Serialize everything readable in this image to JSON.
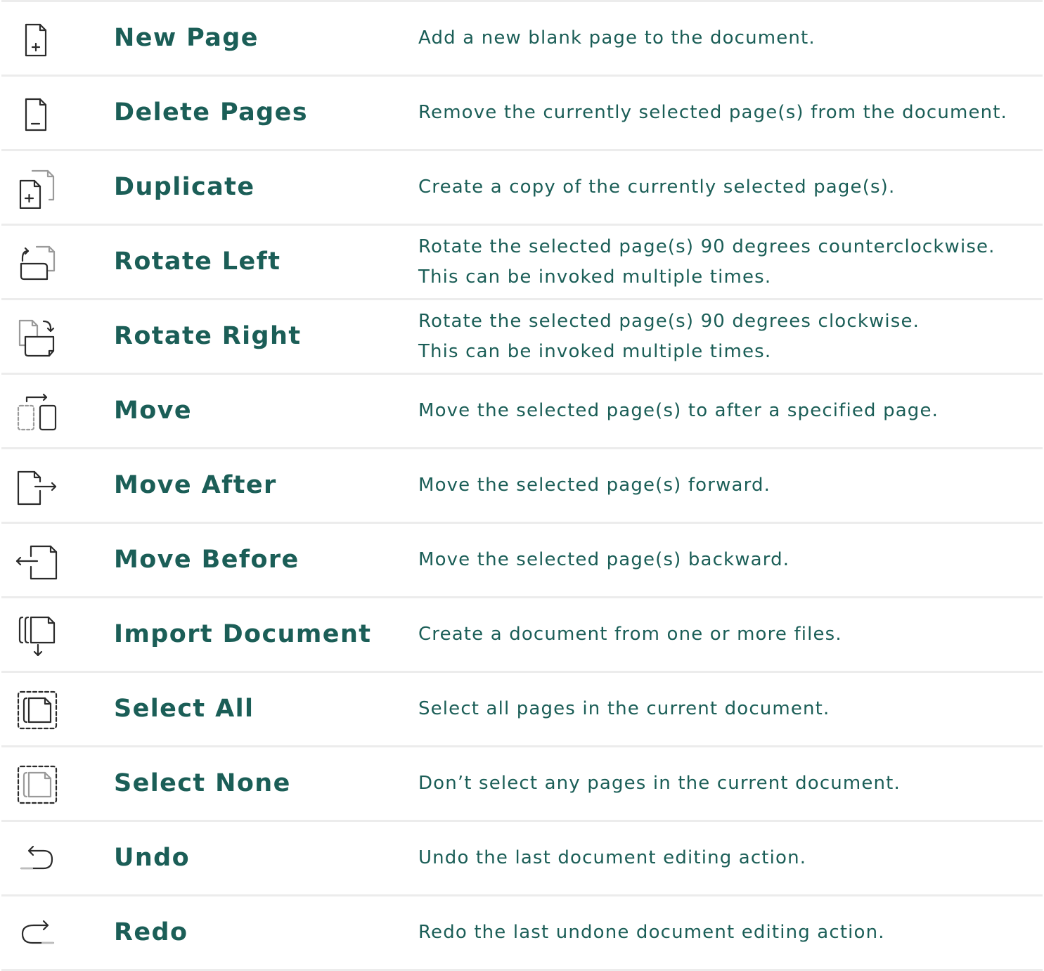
{
  "commands": [
    {
      "icon": "new-page-icon",
      "name": "New Page",
      "description": [
        "Add a new blank page to the document.",
        ""
      ]
    },
    {
      "icon": "delete-pages-icon",
      "name": "Delete Pages",
      "description": [
        "Remove the currently selected page(s) from the document.",
        ""
      ]
    },
    {
      "icon": "duplicate-icon",
      "name": "Duplicate",
      "description": [
        "Create a copy of the currently selected page(s).",
        ""
      ]
    },
    {
      "icon": "rotate-left-icon",
      "name": "Rotate Left",
      "description": [
        "Rotate the selected page(s) 90 degrees counterclockwise.",
        "This can be invoked multiple times."
      ]
    },
    {
      "icon": "rotate-right-icon",
      "name": "Rotate Right",
      "description": [
        "Rotate the selected page(s) 90 degrees clockwise.",
        "This can be invoked multiple times."
      ]
    },
    {
      "icon": "move-icon",
      "name": "Move",
      "description": [
        "Move the selected page(s) to after a specified page.",
        ""
      ]
    },
    {
      "icon": "move-after-icon",
      "name": "Move After",
      "description": [
        "Move the selected page(s) forward.",
        ""
      ]
    },
    {
      "icon": "move-before-icon",
      "name": "Move Before",
      "description": [
        "Move the selected page(s) backward.",
        ""
      ]
    },
    {
      "icon": "import-document-icon",
      "name": "Import Document",
      "description": [
        "Create a document from one or more files.",
        ""
      ]
    },
    {
      "icon": "select-all-icon",
      "name": "Select All",
      "description": [
        "Select all pages in the current document.",
        ""
      ]
    },
    {
      "icon": "select-none-icon",
      "name": "Select None",
      "description": [
        "Don’t select any pages in the current document.",
        ""
      ]
    },
    {
      "icon": "undo-icon",
      "name": "Undo",
      "description": [
        "Undo the last document editing action.",
        ""
      ]
    },
    {
      "icon": "redo-icon",
      "name": "Redo",
      "description": [
        "Redo the last undone document editing action.",
        ""
      ]
    }
  ],
  "colors": {
    "text": "#1b5e57",
    "icon": "#2b2b2b",
    "icon_faded": "#9a9a9a",
    "divider": "#ececec"
  }
}
